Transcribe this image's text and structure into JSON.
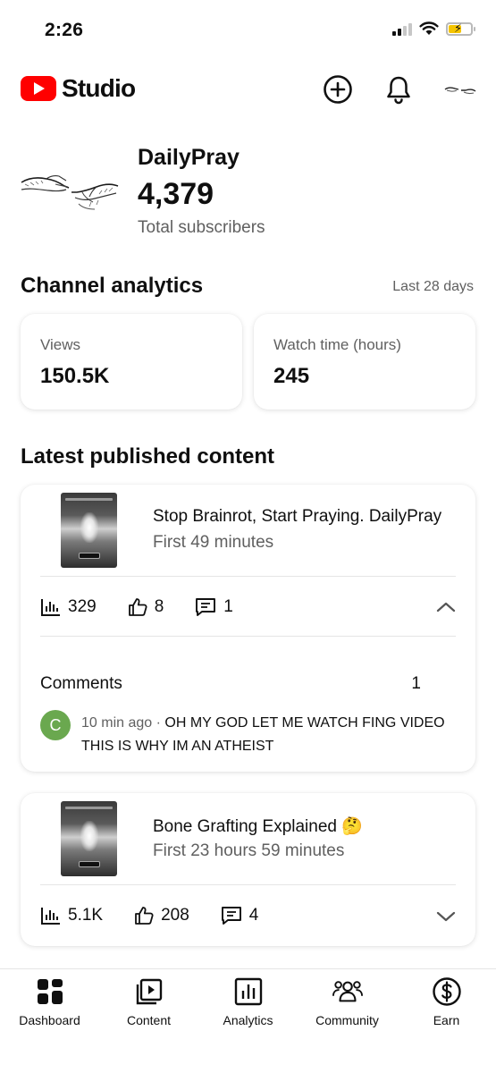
{
  "status_bar": {
    "time": "2:26"
  },
  "header": {
    "logo_text": "Studio"
  },
  "channel": {
    "name": "DailyPray",
    "subscriber_count": "4,379",
    "subscriber_label": "Total subscribers"
  },
  "analytics": {
    "title": "Channel analytics",
    "range": "Last 28 days",
    "metrics": [
      {
        "label": "Views",
        "value": "150.5K"
      },
      {
        "label": "Watch time (hours)",
        "value": "245"
      }
    ]
  },
  "latest": {
    "title": "Latest published content",
    "videos": [
      {
        "title": "Stop Brainrot, Start Praying. DailyPray",
        "subtitle": "First 49 minutes",
        "views": "329",
        "likes": "8",
        "comments": "1",
        "expanded": true,
        "comments_label": "Comments",
        "comments_count": "1",
        "comment": {
          "author_initial": "C",
          "time": "10 min ago · ",
          "text": "OH MY GOD LET ME WATCH FING VIDEO THIS IS WHY IM AN ATHEIST",
          "avatar_color": "#6aa84f"
        }
      },
      {
        "title": "Bone Grafting Explained 🤔",
        "subtitle": "First 23 hours 59 minutes",
        "views": "5.1K",
        "likes": "208",
        "comments": "4",
        "expanded": false
      }
    ]
  },
  "nav": {
    "items": [
      {
        "label": "Dashboard",
        "icon": "dashboard-icon",
        "active": true
      },
      {
        "label": "Content",
        "icon": "content-icon"
      },
      {
        "label": "Analytics",
        "icon": "analytics-icon"
      },
      {
        "label": "Community",
        "icon": "community-icon"
      },
      {
        "label": "Earn",
        "icon": "earn-icon"
      }
    ]
  },
  "colors": {
    "brand_red": "#ff0000",
    "secondary_text": "#606060",
    "battery": "#f5c400"
  }
}
